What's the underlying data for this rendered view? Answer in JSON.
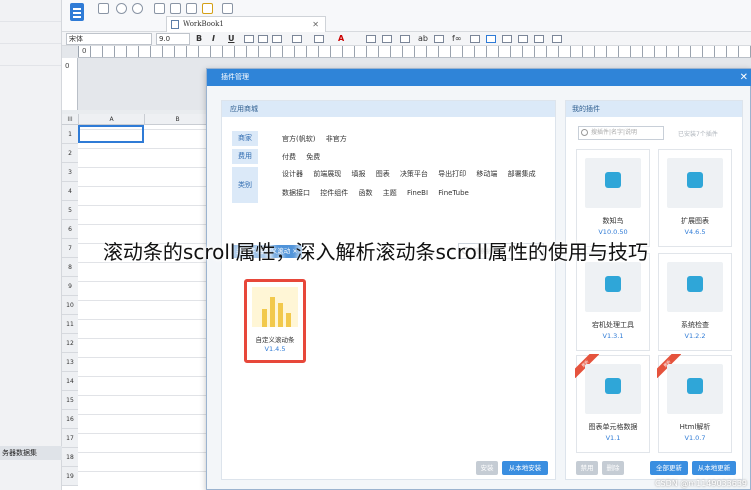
{
  "toolbar": {
    "tab_title": "WorkBook1"
  },
  "format_bar": {
    "font_family": "宋体",
    "font_size": "9.0",
    "bold": "B",
    "italic": "I",
    "underline": "U",
    "text_ab": "ab",
    "fx": "f∞"
  },
  "ruler": {
    "h0": "0",
    "v0": "0"
  },
  "grid": {
    "corner": "III",
    "columns": [
      "A",
      "B"
    ],
    "rows": [
      "1",
      "2",
      "3",
      "4",
      "5",
      "6",
      "7",
      "8",
      "9",
      "10",
      "11",
      "12",
      "13",
      "14",
      "15",
      "16",
      "17",
      "18",
      "19"
    ]
  },
  "left_panel": {
    "label": "务器数据集"
  },
  "dialog": {
    "title": "插件管理",
    "store": {
      "header": "应用商城",
      "filters": [
        {
          "label": "商家",
          "options": [
            "官方(帆软)",
            "非官方"
          ]
        },
        {
          "label": "费用",
          "options": [
            "付费",
            "免费"
          ]
        },
        {
          "label": "类别",
          "options": [
            "设计器",
            "前端展现",
            "填报",
            "图表",
            "决策平台",
            "导出打印",
            "移动端",
            "部署集成"
          ],
          "options2": [
            "数据接口",
            "控件组件",
            "函数",
            "主题",
            "FineBI",
            "FineTube"
          ]
        }
      ],
      "keyword_chip": "关键字:自定义滚动",
      "keyword_close": "×",
      "search_placeholder": "搜索插件",
      "result_card": {
        "name": "自定义滚动条",
        "version": "V1.4.5"
      },
      "install_button": "安装",
      "install_local_button": "从本地安装"
    },
    "mine": {
      "header": "我的插件",
      "search_placeholder": "搜插件|名字|说明",
      "count_text": "已安装7个插件",
      "plugins": [
        {
          "name": "数知鸟",
          "version": "V10.0.50",
          "badge": ""
        },
        {
          "name": "扩展图表",
          "version": "V4.6.5",
          "badge": ""
        },
        {
          "name": "宕机处理工具",
          "version": "V1.3.1",
          "badge": ""
        },
        {
          "name": "系统检查",
          "version": "V1.2.2",
          "badge": ""
        },
        {
          "name": "图表单元格数据",
          "version": "V1.1",
          "badge": "更新"
        },
        {
          "name": "Html解析",
          "version": "V1.0.7",
          "badge": "更新"
        }
      ],
      "disable_button": "禁用",
      "delete_button": "删除",
      "update_all_button": "全部更新",
      "update_local_button": "从本地更新"
    }
  },
  "caption": "滚动条的scroll属性，深入解析滚动条scroll属性的使用与技巧",
  "watermark": "CSDN @m1149033639"
}
